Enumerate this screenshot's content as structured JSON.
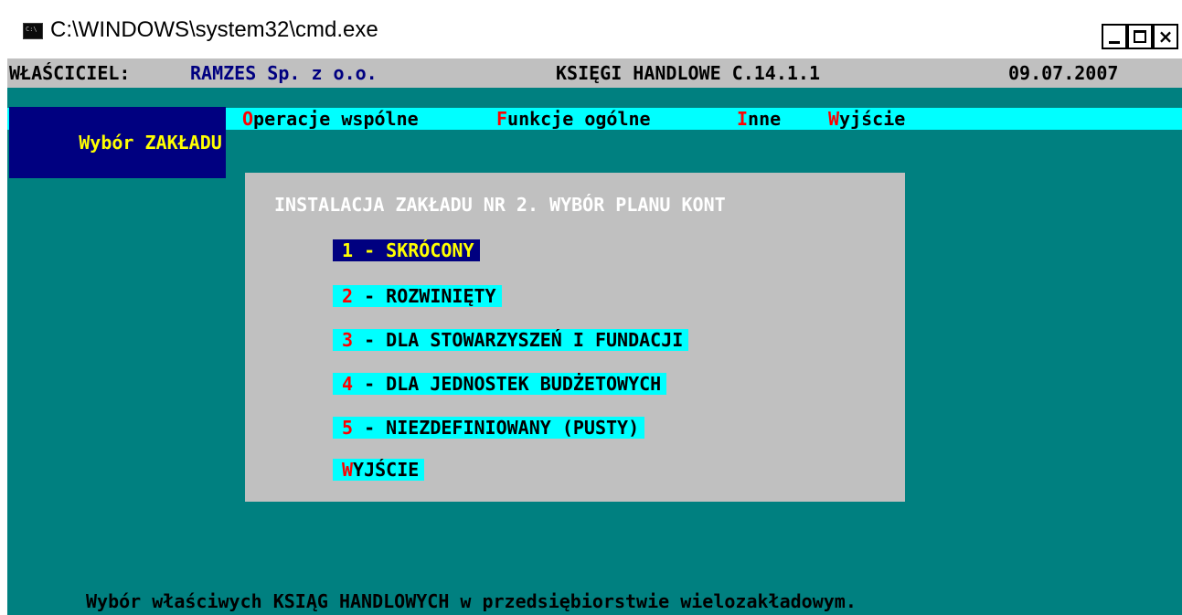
{
  "window": {
    "title": "C:\\WINDOWS\\system32\\cmd.exe"
  },
  "header": {
    "owner_label": "WŁAŚCICIEL:",
    "company": "RAMZES Sp. z o.o.",
    "app": "KSIĘGI HANDLOWE C.14.1.1",
    "date": "09.07.2007"
  },
  "menu": {
    "items": [
      {
        "hot": "",
        "rest": "Wybór ZAKŁADU",
        "full": "Wybór ZAKŁADU"
      },
      {
        "hot": "O",
        "rest": "peracje wspólne"
      },
      {
        "hot": "F",
        "rest": "unkcje ogólne"
      },
      {
        "hot": "I",
        "rest": "nne"
      },
      {
        "hot": "W",
        "rest": "yjście"
      }
    ]
  },
  "dialog": {
    "title": "INSTALACJA ZAKŁADU NR 2. WYBÓR PLANU KONT",
    "options": [
      {
        "num": "1",
        "text": " - SKRÓCONY",
        "selected": true
      },
      {
        "num": "2",
        "text": " - ROZWINIĘTY",
        "selected": false
      },
      {
        "num": "3",
        "text": " - DLA STOWARZYSZEŃ I FUNDACJI",
        "selected": false
      },
      {
        "num": "4",
        "text": " - DLA JEDNOSTEK BUDŻETOWYCH",
        "selected": false
      },
      {
        "num": "5",
        "text": " - NIEZDEFINIOWANY (PUSTY)",
        "selected": false
      },
      {
        "num": "W",
        "text": "YJŚCIE",
        "selected": false
      }
    ]
  },
  "footer": {
    "text": "Wybór właściwych KSIĄG HANDLOWYCH w przedsiębiorstwie wielozakładowym."
  },
  "colors": {
    "background": "#008080",
    "menubar": "#00ffff",
    "selected": "#000080",
    "hotkey": "#ff0000",
    "highlight_text": "#ffff00",
    "dialog": "#c0c0c0"
  },
  "icons": {
    "app": "cmd-icon",
    "minimize": "minimize-icon",
    "maximize": "maximize-icon",
    "close": "close-icon"
  }
}
